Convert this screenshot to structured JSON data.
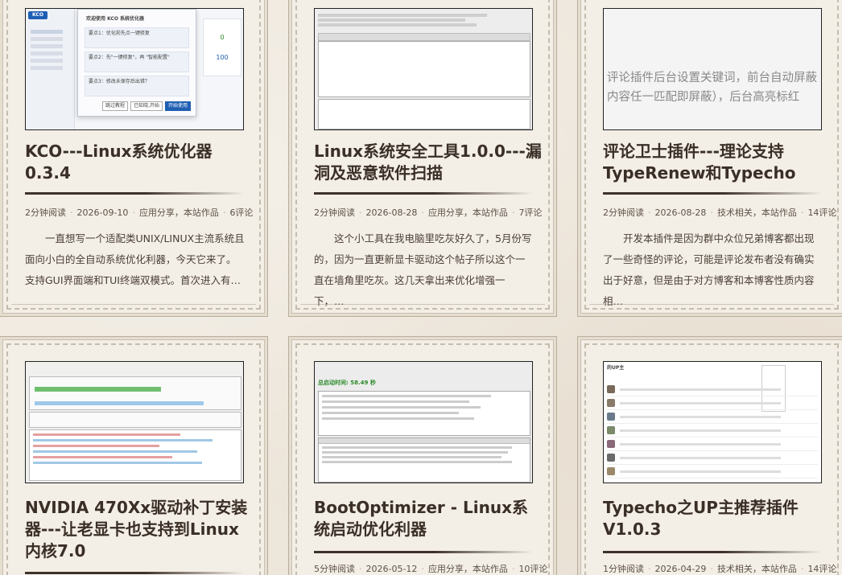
{
  "cards": [
    {
      "title": "KCO---Linux系统优化器 0.3.4",
      "meta": {
        "read": "2分钟阅读",
        "date": "2026-09-10",
        "category": "应用分享，本站作品",
        "comments": "6评论"
      },
      "excerpt": "一直想写一个适配类UNIX/LINUX主流系统且面向小白的全自动系统优化利器，今天它来了。支持GUI界面端和TUI终端双模式。首次进入有…",
      "thumb": {
        "app": "KCO",
        "dialog_title": "欢迎使用 KCO 系统优化器",
        "nums": [
          "0",
          "100"
        ],
        "steps": [
          "要点1：优化前先点一键修复",
          "要点2：先\"一键修复\"，再 \"智能配置\"",
          "要点3：修改未保存后出错？"
        ],
        "buttons": [
          "跳过教程",
          "已知晓,开始",
          "开始使用"
        ]
      }
    },
    {
      "title": "Linux系统安全工具1.0.0---漏洞及恶意软件扫描",
      "meta": {
        "read": "2分钟阅读",
        "date": "2026-08-28",
        "category": "应用分享，本站作品",
        "comments": "7评论"
      },
      "excerpt": "这个小工具在我电脑里吃灰好久了，5月份写的，因为一直更新显卡驱动这个帖子所以这个一直在墙角里吃灰。这几天拿出来优化增强一下，…"
    },
    {
      "title": "评论卫士插件---理论支持TypeRenew和Typecho",
      "meta": {
        "read": "2分钟阅读",
        "date": "2026-08-28",
        "category": "技术相关，本站作品",
        "comments": "14评论"
      },
      "excerpt": "开发本插件是因为群中众位兄弟博客都出现了一些奇怪的评论，可能是评论发布者没有确实出于好意，但是由于对方博客和本博客性质内容相…",
      "thumb_text": "评论插件后台设置关键词，前台自动屏蔽内容任一匹配即屏蔽），后台高亮标红"
    },
    {
      "title": "NVIDIA 470Xx驱动补丁安装器---让老显卡也支持到Linux内核7.0",
      "meta": {
        "read": "",
        "date": "",
        "category": "",
        "comments": ""
      },
      "excerpt": ""
    },
    {
      "title": "BootOptimizer - Linux系统启动优化利器",
      "meta": {
        "read": "5分钟阅读",
        "date": "2026-05-12",
        "category": "应用分享，本站作品",
        "comments": "10评论"
      },
      "excerpt": "",
      "thumb": {
        "score_label": "总启动时间: 58.49 秒"
      }
    },
    {
      "title": "Typecho之UP主推荐插件V1.0.3",
      "meta": {
        "read": "1分钟阅读",
        "date": "2026-04-29",
        "category": "技术相关，本站作品",
        "comments": "14评论"
      },
      "excerpt": "",
      "thumb": {
        "header": "的UP主"
      }
    }
  ],
  "colors": {
    "background": "#eee7dc",
    "card": "#f3eee6",
    "title": "#3a2f27",
    "accent_green": "#3a9a3a",
    "accent_blue": "#2f6fd1"
  }
}
